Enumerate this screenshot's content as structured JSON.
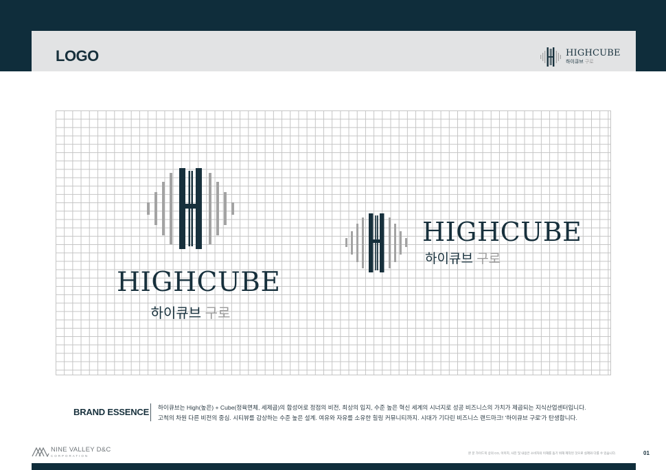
{
  "header": {
    "title": "LOGO",
    "logo_wordmark": "HIGHCUBE",
    "logo_sub_dark": "하이큐브",
    "logo_sub_gray": "구로"
  },
  "logo_vertical": {
    "wordmark": "HIGHCUBE",
    "sub_dark": "하이큐브",
    "sub_gray": "구로"
  },
  "logo_horizontal": {
    "wordmark": "HIGHCUBE",
    "sub_dark": "하이큐브",
    "sub_gray": "구로"
  },
  "brand_essence": {
    "label": "BRAND ESSENCE",
    "line1": "하이큐브는 High(높은) + Cube(정육면체, 세제곱)의 합성어로 정점의 비전, 최상의 입지, 수준 높은 혁신 세계의 시너지로 성공 비즈니스의 가치가 제곱되는 지식산업센터입니다.",
    "line2": "고척의 차원 다른 비전의 중심. 시티뷰를 감상하는 수준 높은 설계. 여유와 자유를 소유한 힐링 커뮤니티까지. 시대가 기다린 비즈니스 랜드마크! '하이큐브 구로'가 탄생합니다."
  },
  "footer": {
    "company": "NINE VALLEY D&C",
    "company_sub": "CORPORATION",
    "note": "본 문 가이드북 상의 CG, 이미지, 사진 및 내용은 소비자의 이해를 돕기 위해 제작된 것으로 실제와 다를 수 있습니다.",
    "page": "01"
  },
  "colors": {
    "navy": "#0f2d3b",
    "mark_dark": "#17303c",
    "mark_gray": "#a3a3a3",
    "header_gray": "#e2e3e4"
  }
}
